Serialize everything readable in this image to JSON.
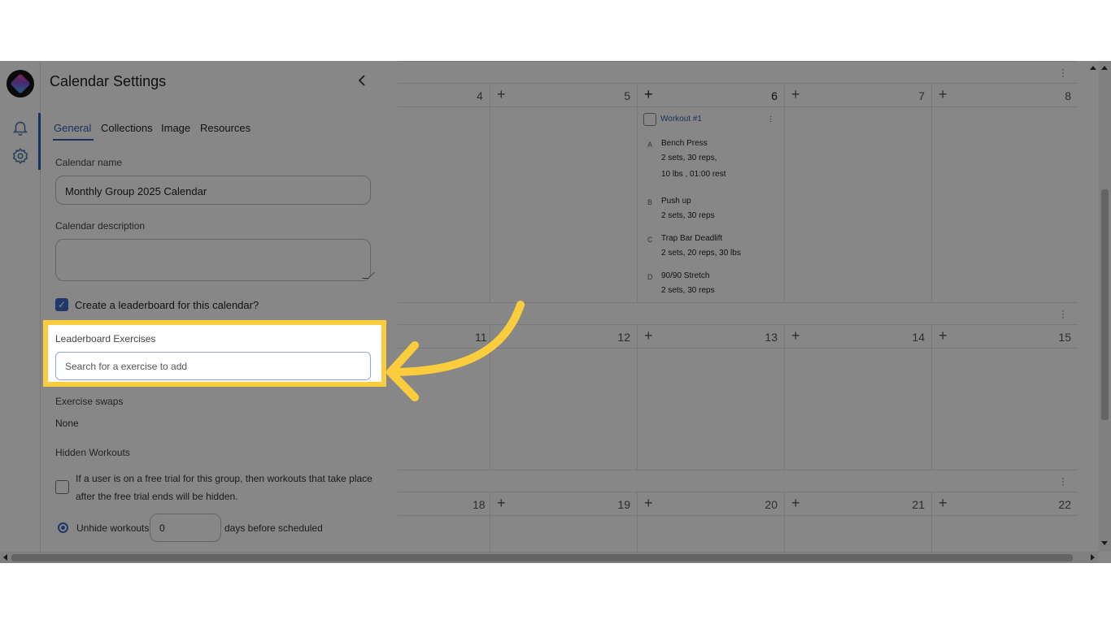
{
  "panel": {
    "title": "Calendar Settings",
    "tabs": [
      "General",
      "Collections",
      "Image",
      "Resources"
    ],
    "active_tab": "General",
    "calendar_name_label": "Calendar name",
    "calendar_name_value": "Monthly Group 2025 Calendar",
    "calendar_description_label": "Calendar description",
    "calendar_description_value": "",
    "leaderboard_checkbox_label": "Create a leaderboard for this calendar?",
    "leaderboard_checked": true,
    "leaderboard_exercises_label": "Leaderboard Exercises",
    "leaderboard_search_placeholder": "Search for a exercise to add",
    "exercise_swaps_label": "Exercise swaps",
    "exercise_swaps_value": "None",
    "hidden_workouts_label": "Hidden Workouts",
    "trial_text": "If a user is on a free trial for this group, then workouts that take place after the free trial ends will be hidden.",
    "unhide_label": "Unhide workouts",
    "unhide_value": "0",
    "unhide_suffix": "days before scheduled"
  },
  "rail": {
    "icons": [
      "logo",
      "bell-icon",
      "gear-icon"
    ]
  },
  "calendar": {
    "week1_days": [
      "4",
      "5",
      "6",
      "7",
      "8"
    ],
    "week2_days": [
      "11",
      "12",
      "13",
      "14",
      "15"
    ],
    "week3_days": [
      "18",
      "19",
      "20",
      "21",
      "22"
    ],
    "workout": {
      "title": "Workout #1",
      "exercises": [
        {
          "letter": "A",
          "name": "Bench Press",
          "detail1": "2 sets, 30 reps,",
          "detail2": "10 lbs , 01:00 rest"
        },
        {
          "letter": "B",
          "name": "Push up",
          "detail1": "2 sets, 30 reps"
        },
        {
          "letter": "C",
          "name": "Trap Bar Deadlift",
          "detail1": "2 sets, 20 reps, 30 lbs"
        },
        {
          "letter": "D",
          "name": "90/90 Stretch",
          "detail1": "2 sets, 30 reps"
        }
      ]
    }
  },
  "colors": {
    "accent": "#2f5fb5",
    "highlight": "#fbcd3c",
    "overlay": "rgba(0,0,0,0.47)"
  }
}
